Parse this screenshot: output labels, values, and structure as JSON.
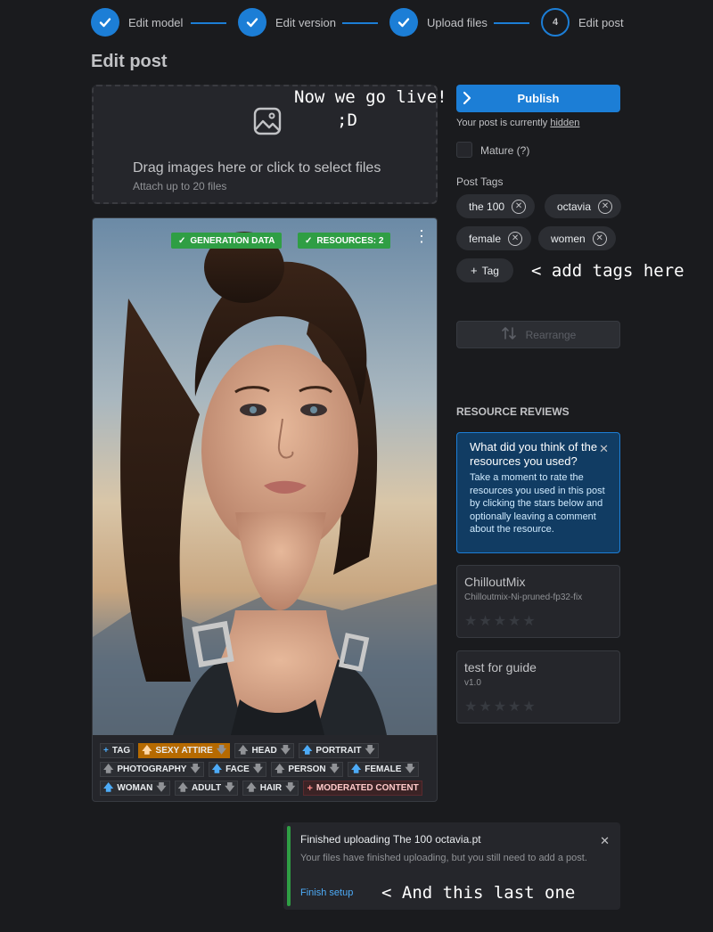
{
  "stepper": {
    "steps": [
      {
        "label": "Edit model",
        "state": "done"
      },
      {
        "label": "Edit version",
        "state": "done"
      },
      {
        "label": "Upload files",
        "state": "done"
      },
      {
        "label": "Edit post",
        "state": "current",
        "number": "4"
      }
    ]
  },
  "page_title": "Edit post",
  "dropzone": {
    "main_text": "Drag images here or click to select files",
    "sub_text": "Attach up to 20 files"
  },
  "annotations": {
    "live_line1": "Now we go live!",
    "live_line2": ";D",
    "tags": "< add tags here",
    "last": "< And this last one"
  },
  "image_card": {
    "badges": [
      "GENERATION DATA",
      "RESOURCES: 2"
    ],
    "add_tag_label": "TAG",
    "tag_rows": [
      [
        {
          "label": "SEXY ATTIRE",
          "style": "sexy",
          "voted": "up"
        },
        {
          "label": "HEAD",
          "style": "normal",
          "voted": "none"
        },
        {
          "label": "PORTRAIT",
          "style": "normal",
          "voted": "up"
        }
      ],
      [
        {
          "label": "PHOTOGRAPHY",
          "style": "normal",
          "voted": "none"
        },
        {
          "label": "FACE",
          "style": "normal",
          "voted": "up"
        },
        {
          "label": "PERSON",
          "style": "normal",
          "voted": "none"
        },
        {
          "label": "FEMALE",
          "style": "normal",
          "voted": "up"
        }
      ],
      [
        {
          "label": "WOMAN",
          "style": "normal",
          "voted": "up"
        },
        {
          "label": "ADULT",
          "style": "normal",
          "voted": "none"
        },
        {
          "label": "HAIR",
          "style": "normal",
          "voted": "none"
        },
        {
          "label": "MODERATED CONTENT",
          "style": "mod",
          "voted": "none"
        }
      ]
    ]
  },
  "sidebar": {
    "publish_label": "Publish",
    "status_prefix": "Your post is currently ",
    "status_value": "hidden",
    "mature_label": "Mature (?)",
    "tags_label": "Post Tags",
    "tags": [
      "the 100",
      "octavia",
      "female",
      "women"
    ],
    "add_tag_label": "Tag",
    "rearrange_label": "Rearrange",
    "resource_reviews_title": "RESOURCE REVIEWS",
    "alert": {
      "title": "What did you think of the resources you used?",
      "body": "Take a moment to rate the resources you used in this post by clicking the stars below and optionally leaving a comment about the resource."
    },
    "resources": [
      {
        "name": "ChilloutMix",
        "version": "Chilloutmix-Ni-pruned-fp32-fix",
        "rating": 0
      },
      {
        "name": "test for guide",
        "version": "v1.0",
        "rating": 0
      }
    ]
  },
  "toast": {
    "title": "Finished uploading The 100 octavia.pt",
    "message": "Your files have finished uploading, but you still need to add a post.",
    "link": "Finish setup"
  },
  "colors": {
    "background": "#1a1b1e",
    "accent": "#1c7ed6",
    "success": "#2f9e44",
    "sexy_tag": "#b66a00"
  }
}
